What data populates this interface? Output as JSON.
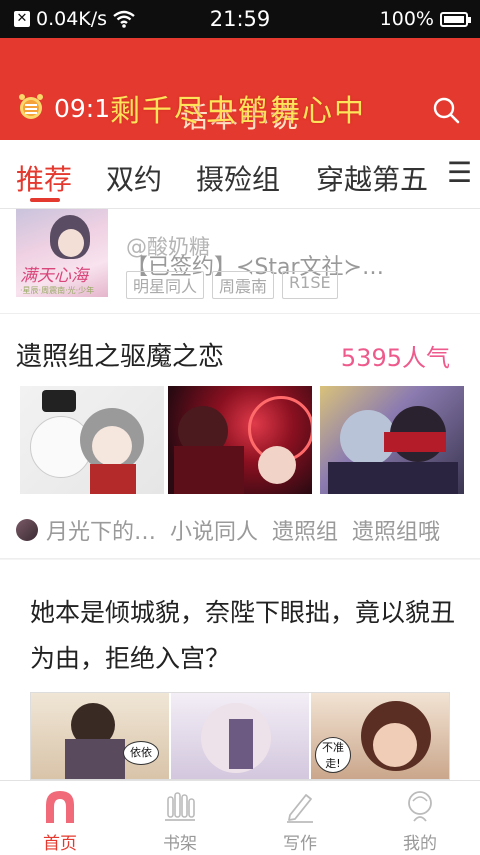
{
  "status_bar": {
    "network_speed": "0.04K/s",
    "time": "21:59",
    "battery": "100%"
  },
  "header": {
    "time": "09:1",
    "app_title": "话本小说",
    "marquee": "剩千尽虫鹤舞心中"
  },
  "tabs": [
    {
      "label": "推荐",
      "active": true
    },
    {
      "label": "双约"
    },
    {
      "label": "摄殓组"
    },
    {
      "label": "穿越第五"
    }
  ],
  "card1": {
    "cover_title": "满天心海",
    "cover_sub": "·星辰·周震南·光·少年",
    "author": "@酸奶糖",
    "book_title": "【已签约】≺Star文社≻…",
    "tags": [
      "明星同人",
      "周震南",
      "R1SE"
    ]
  },
  "card2": {
    "title": "遗照组之驱魔之恋",
    "popularity": "5395人气",
    "author": "月光下的…",
    "tags": [
      "小说同人",
      "遗照组",
      "遗照组哦"
    ]
  },
  "card3": {
    "text": "她本是倾城貌，奈陛下眼拙，竟以貌丑为由，拒绝入宫？",
    "bubbles": [
      "依依",
      "不准走!"
    ]
  },
  "bottom_nav": [
    {
      "label": "首页",
      "icon": "home-icon",
      "active": true
    },
    {
      "label": "书架",
      "icon": "bookshelf-icon"
    },
    {
      "label": "写作",
      "icon": "pen-icon"
    },
    {
      "label": "我的",
      "icon": "profile-icon"
    }
  ],
  "colors": {
    "accent": "#e4392e",
    "popularity": "#ee5a8c",
    "marquee": "#ffe35a"
  }
}
